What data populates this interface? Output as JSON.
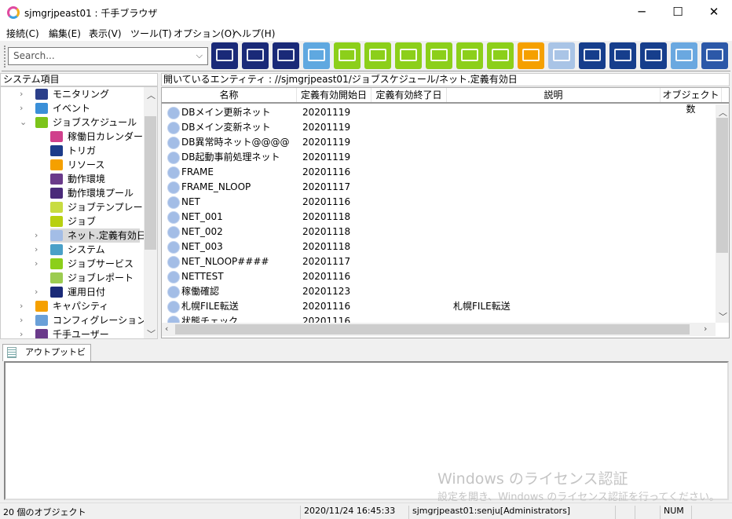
{
  "window": {
    "title": "sjmgrjpeast01 : 千手ブラウザ",
    "minimize": "─",
    "maximize": "☐",
    "close": "✕"
  },
  "menu": [
    "接続(C)",
    "編集(E)",
    "表示(V)",
    "ツール(T)",
    "オプション(O)",
    "ヘルプ(H)"
  ],
  "search": {
    "placeholder": "Search..."
  },
  "toolbar_icons": [
    {
      "name": "monitor-grid-icon",
      "color": "#1a2a78"
    },
    {
      "name": "monitor-icon",
      "color": "#1a2a78"
    },
    {
      "name": "monitor-stack-icon",
      "color": "#1a2a78"
    },
    {
      "name": "message-icon",
      "color": "#5fa8e0"
    },
    {
      "name": "gear-job-icon",
      "color": "#8ccf1a"
    },
    {
      "name": "check-job-icon",
      "color": "#8ccf1a"
    },
    {
      "name": "video-job-icon",
      "color": "#8ccf1a"
    },
    {
      "name": "monitor-check-icon",
      "color": "#8ccf1a"
    },
    {
      "name": "bar-report-icon",
      "color": "#8ccf1a"
    },
    {
      "name": "gantt-icon",
      "color": "#8ccf1a"
    },
    {
      "name": "capacity-chart-icon",
      "color": "#f5a000"
    },
    {
      "name": "configuration-icon",
      "color": "#a9c4e6"
    },
    {
      "name": "gear-export-icon",
      "color": "#163e8c"
    },
    {
      "name": "check-export-icon",
      "color": "#163e8c"
    },
    {
      "name": "video-export-icon",
      "color": "#163e8c"
    },
    {
      "name": "log-icon",
      "color": "#6aa8e0"
    },
    {
      "name": "radar-icon",
      "color": "#2c58a8"
    }
  ],
  "left_panel": {
    "header": "システム項目",
    "tree": [
      {
        "label": "モニタリング",
        "level": 0,
        "expander": "›",
        "icon": "monitoring-icon",
        "color": "#2b3f8a"
      },
      {
        "label": "イベント",
        "level": 0,
        "expander": "›",
        "icon": "event-icon",
        "color": "#3a8fd8"
      },
      {
        "label": "ジョブスケジュール",
        "level": 0,
        "expander": "⌄",
        "icon": "job-schedule-icon",
        "color": "#7cc41a"
      },
      {
        "label": "稼働日カレンダー",
        "level": 1,
        "expander": "",
        "icon": "calendar-icon",
        "color": "#d0408c"
      },
      {
        "label": "トリガ",
        "level": 1,
        "expander": "",
        "icon": "trigger-icon",
        "color": "#1d3c8a"
      },
      {
        "label": "リソース",
        "level": 1,
        "expander": "",
        "icon": "resource-icon",
        "color": "#f5a000"
      },
      {
        "label": "動作環境",
        "level": 1,
        "expander": "",
        "icon": "environment-icon",
        "color": "#6a3a8a"
      },
      {
        "label": "動作環境プール",
        "level": 1,
        "expander": "",
        "icon": "environment-pool-icon",
        "color": "#4a2a7a"
      },
      {
        "label": "ジョブテンプレート",
        "level": 1,
        "expander": "",
        "icon": "job-template-icon",
        "color": "#c8dc40"
      },
      {
        "label": "ジョブ",
        "level": 1,
        "expander": "",
        "icon": "job-icon",
        "color": "#b8d010"
      },
      {
        "label": "ネット.定義有効日",
        "level": 1,
        "expander": "›",
        "icon": "net-validity-icon",
        "color": "#a3bde6",
        "selected": true
      },
      {
        "label": "システム",
        "level": 1,
        "expander": "›",
        "icon": "system-icon",
        "color": "#4aa0c8"
      },
      {
        "label": "ジョブサービス",
        "level": 1,
        "expander": "›",
        "icon": "job-service-icon",
        "color": "#8ccf1a"
      },
      {
        "label": "ジョブレポート",
        "level": 1,
        "expander": "",
        "icon": "job-report-icon",
        "color": "#9ccc50"
      },
      {
        "label": "運用日付",
        "level": 1,
        "expander": "›",
        "icon": "operation-date-icon",
        "color": "#1a2a78"
      },
      {
        "label": "キャパシティ",
        "level": 0,
        "expander": "›",
        "icon": "capacity-icon",
        "color": "#f5a000"
      },
      {
        "label": "コンフィグレーション",
        "level": 0,
        "expander": "›",
        "icon": "configuration-icon",
        "color": "#6aa0d8"
      },
      {
        "label": "千手ユーザー",
        "level": 0,
        "expander": "›",
        "icon": "user-icon",
        "color": "#6a3a8a"
      }
    ]
  },
  "main": {
    "path": "開いているエンティティ : //sjmgrjpeast01/ジョブスケジュール/ネット.定義有効日",
    "columns": [
      "名称",
      "定義有効開始日",
      "定義有効終了日",
      "説明",
      "オブジェクト数"
    ],
    "rows": [
      {
        "name": "DBメイン更新ネット",
        "start": "20201119",
        "end": "",
        "desc": ""
      },
      {
        "name": "DBメイン変新ネット",
        "start": "20201119",
        "end": "",
        "desc": ""
      },
      {
        "name": "DB異常時ネット@@@@",
        "start": "20201119",
        "end": "",
        "desc": ""
      },
      {
        "name": "DB起動事前処理ネット",
        "start": "20201119",
        "end": "",
        "desc": ""
      },
      {
        "name": "FRAME",
        "start": "20201116",
        "end": "",
        "desc": ""
      },
      {
        "name": "FRAME_NLOOP",
        "start": "20201117",
        "end": "",
        "desc": ""
      },
      {
        "name": "NET",
        "start": "20201116",
        "end": "",
        "desc": ""
      },
      {
        "name": "NET_001",
        "start": "20201118",
        "end": "",
        "desc": ""
      },
      {
        "name": "NET_002",
        "start": "20201118",
        "end": "",
        "desc": ""
      },
      {
        "name": "NET_003",
        "start": "20201118",
        "end": "",
        "desc": ""
      },
      {
        "name": "NET_NLOOP####",
        "start": "20201117",
        "end": "",
        "desc": ""
      },
      {
        "name": "NETTEST",
        "start": "20201116",
        "end": "",
        "desc": ""
      },
      {
        "name": "稼働確認",
        "start": "20201123",
        "end": "",
        "desc": ""
      },
      {
        "name": "札幌FILE転送",
        "start": "20201116",
        "end": "",
        "desc": "札幌FILE転送"
      },
      {
        "name": "状態チェック",
        "start": "20201116",
        "end": "",
        "desc": ""
      }
    ]
  },
  "output": {
    "tab_label": "アウトプットビュー"
  },
  "watermark": {
    "title": "Windows のライセンス認証",
    "subtitle": "設定を開き、Windows のライセンス認証を行ってください。"
  },
  "status": {
    "count": "20 個のオブジェクト",
    "datetime": "2020/11/24 16:45:33",
    "user": "sjmgrjpeast01:senju[Administrators]",
    "num": "NUM"
  }
}
